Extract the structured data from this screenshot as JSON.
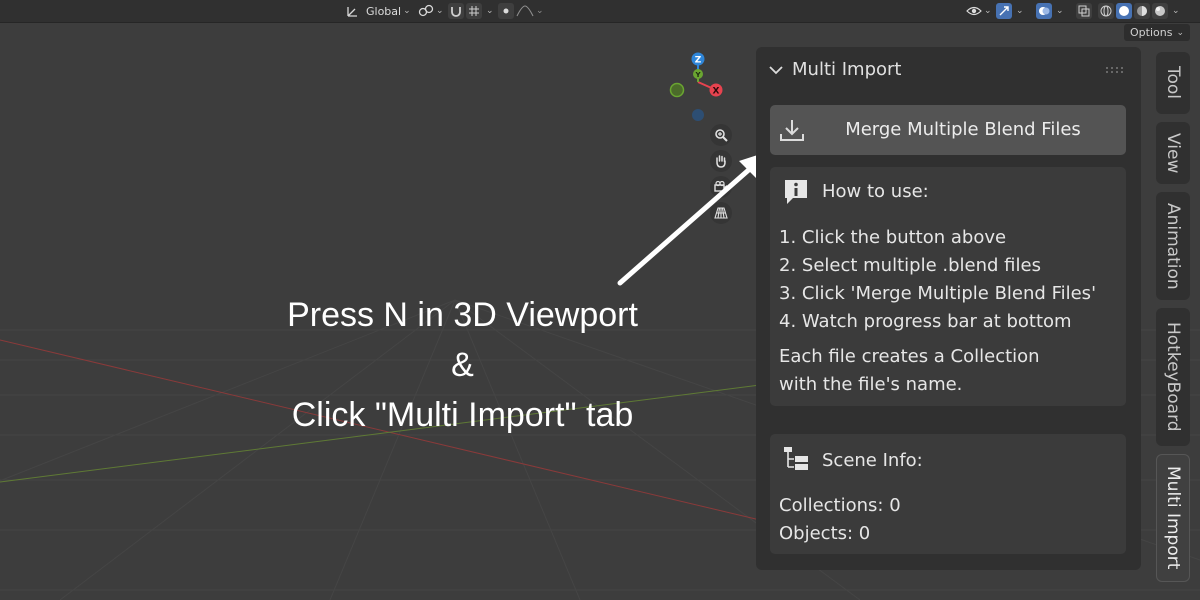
{
  "header": {
    "orientation_label": "Global",
    "options_label": "Options"
  },
  "gizmo": {
    "z_label": "Z",
    "y_label": "Y",
    "x_label": "X",
    "colors": {
      "x": "#e7434f",
      "y": "#6aa531",
      "z": "#2f86d9"
    }
  },
  "caption": {
    "line1": "Press N in 3D Viewport",
    "line2": "&",
    "line3": "Click \"Multi Import\" tab"
  },
  "panel": {
    "title": "Multi Import",
    "merge_button_label": "Merge Multiple Blend Files",
    "how_to": {
      "title": "How to use:",
      "steps": [
        "1. Click the button above",
        "2. Select multiple .blend files",
        "3. Click 'Merge Multiple Blend Files'",
        "4. Watch progress bar at bottom"
      ],
      "note_line1": "Each file creates a Collection",
      "note_line2": "with the file's name."
    },
    "scene_info": {
      "title": "Scene Info:",
      "collections": "Collections: 0",
      "objects": "Objects: 0"
    }
  },
  "tabs": [
    "Tool",
    "View",
    "Animation",
    "HotkeyBoard",
    "Multi Import"
  ],
  "active_tab": "Multi Import"
}
